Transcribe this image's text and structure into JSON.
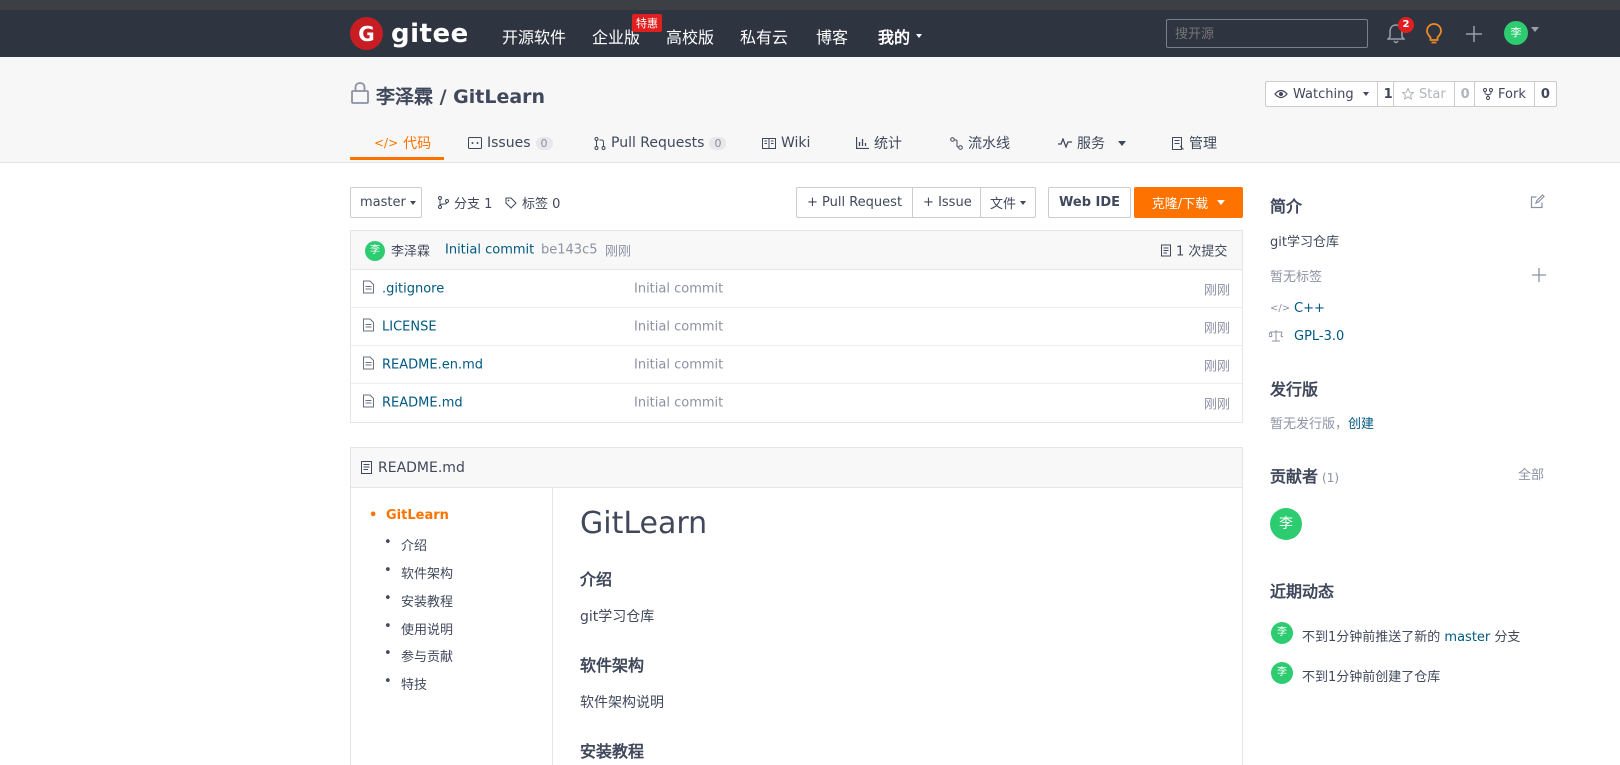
{
  "topnav": {
    "logo_glyph": "G",
    "logo_text": "gitee",
    "items": [
      "开源软件",
      "企业版",
      "高校版",
      "私有云",
      "博客",
      "我的"
    ],
    "badge": "特惠",
    "search_placeholder": "搜开源",
    "notification_count": "2",
    "avatar_initial": "李"
  },
  "project": {
    "title": "李泽霖 / GitLearn",
    "watching_label": "Watching",
    "watching_count": "1",
    "star_label": "Star",
    "star_count": "0",
    "fork_label": "Fork",
    "fork_count": "0"
  },
  "tabs": [
    {
      "label": "代码"
    },
    {
      "label": "Issues",
      "count": "0"
    },
    {
      "label": "Pull Requests",
      "count": "0"
    },
    {
      "label": "Wiki"
    },
    {
      "label": "统计"
    },
    {
      "label": "流水线"
    },
    {
      "label": "服务"
    },
    {
      "label": "管理"
    }
  ],
  "toolbar": {
    "branch": "master",
    "branches": "分支 1",
    "tags": "标签 0",
    "pull_request": "+ Pull Request",
    "issue": "+ Issue",
    "file": "文件",
    "web_ide": "Web IDE",
    "clone": "克隆/下载"
  },
  "commit": {
    "avatar": "李",
    "author": "李泽霖",
    "message": "Initial commit",
    "hash": "be143c5",
    "time": "刚刚",
    "count": "1 次提交"
  },
  "files": [
    {
      "name": ".gitignore",
      "message": "Initial commit",
      "time": "刚刚"
    },
    {
      "name": "LICENSE",
      "message": "Initial commit",
      "time": "刚刚"
    },
    {
      "name": "README.en.md",
      "message": "Initial commit",
      "time": "刚刚"
    },
    {
      "name": "README.md",
      "message": "Initial commit",
      "time": "刚刚"
    }
  ],
  "readme": {
    "filename": "README.md",
    "toc": [
      "GitLearn",
      "介绍",
      "软件架构",
      "安装教程",
      "使用说明",
      "参与贡献",
      "特技"
    ],
    "h1": "GitLearn",
    "h_intro": "介绍",
    "p_intro": "git学习仓库",
    "h_arch": "软件架构",
    "p_arch": "软件架构说明",
    "h_install": "安装教程"
  },
  "sidebar": {
    "intro_title": "简介",
    "intro_text": "git学习仓库",
    "no_tags": "暂无标签",
    "language": "C++",
    "license": "GPL-3.0",
    "release_title": "发行版",
    "release_text": "暂无发行版，",
    "release_create": "创建",
    "contributors_title": "贡献者",
    "contributors_count": "(1)",
    "contributors_all": "全部",
    "contributor_avatar": "李",
    "activity_title": "近期动态",
    "activity_1_pre": "不到1分钟前推送了新的",
    "activity_1_branch": "master",
    "activity_1_post": "分支",
    "activity_2": "不到1分钟前创建了仓库",
    "activity_avatar": "李"
  }
}
